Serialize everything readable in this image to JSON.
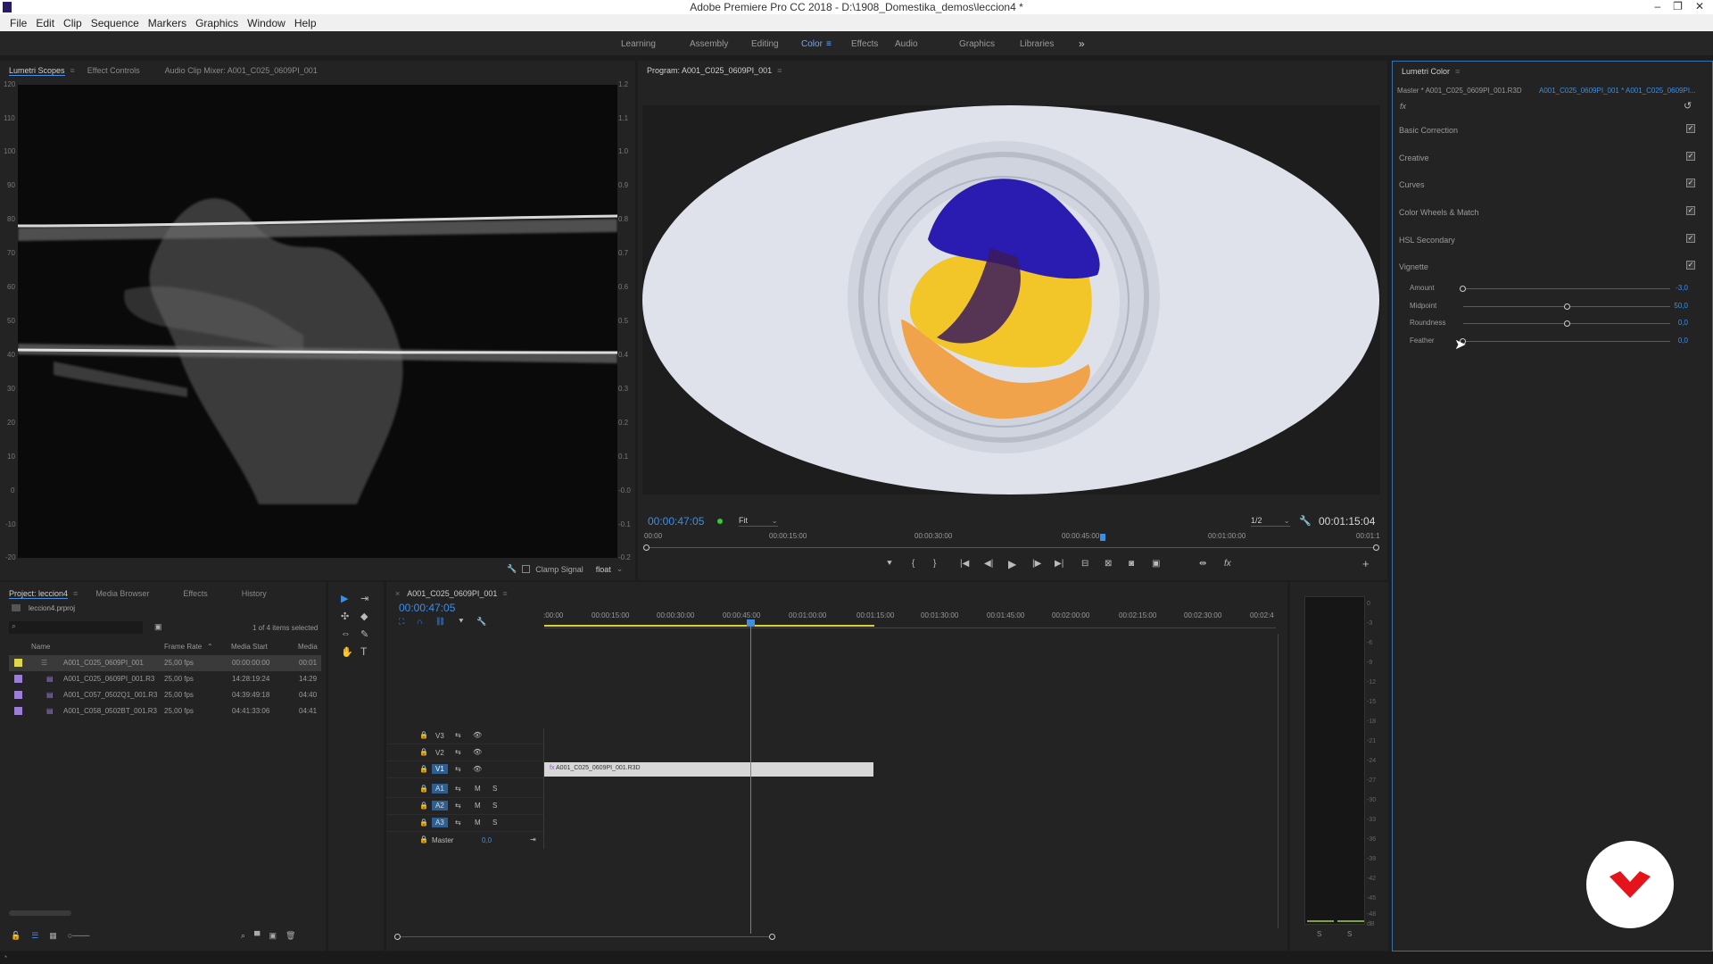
{
  "window": {
    "title": "Adobe Premiere Pro CC 2018 - D:\\1908_Domestika_demos\\leccion4 *",
    "min": "–",
    "restore": "❐",
    "close": "✕"
  },
  "menu": [
    "File",
    "Edit",
    "Clip",
    "Sequence",
    "Markers",
    "Graphics",
    "Window",
    "Help"
  ],
  "workspaces": {
    "tabs": [
      "Learning",
      "Assembly",
      "Editing",
      "Color",
      "Effects",
      "Audio",
      "Graphics",
      "Libraries"
    ],
    "active": "Color",
    "more": "»"
  },
  "scopes": {
    "tabs": [
      "Lumetri Scopes",
      "Effect Controls",
      "Audio Clip Mixer: A001_C025_0609PI_001"
    ],
    "left_ticks": [
      "120",
      "110",
      "100",
      "90",
      "80",
      "70",
      "60",
      "50",
      "40",
      "30",
      "20",
      "10",
      "0",
      "-10",
      "-20"
    ],
    "right_ticks": [
      "1.2",
      "1.1",
      "1.0",
      "0.9",
      "0.8",
      "0.7",
      "0.6",
      "0.5",
      "0.4",
      "0.3",
      "0.2",
      "0.1",
      "-0.0",
      "-0.1",
      "-0.2"
    ],
    "clamp_label": "Clamp Signal",
    "precision": "float"
  },
  "program": {
    "title": "Program: A001_C025_0609PI_001",
    "timecode": "00:00:47:05",
    "fit": "Fit",
    "resolution": "1/2",
    "duration": "00:01:15:04",
    "ruler": [
      "00:00",
      "00:00:15:00",
      "00:00:30:00",
      "00:00:45:00",
      "00:01:00:00",
      "00:01:1"
    ]
  },
  "lumetri": {
    "title": "Lumetri Color",
    "master": "Master * A001_C025_0609PI_001.R3D",
    "clip": "A001_C025_0609PI_001 * A001_C025_0609PI...",
    "fx": "fx",
    "sections": [
      "Basic Correction",
      "Creative",
      "Curves",
      "Color Wheels & Match",
      "HSL Secondary",
      "Vignette"
    ],
    "check": "✓",
    "vignette": [
      {
        "label": "Amount",
        "value": "-3,0",
        "pos": 0
      },
      {
        "label": "Midpoint",
        "value": "50,0",
        "pos": 0.5
      },
      {
        "label": "Roundness",
        "value": "0,0",
        "pos": 0.5
      },
      {
        "label": "Feather",
        "value": "0,0",
        "pos": 0
      }
    ]
  },
  "project": {
    "tabs": [
      "Project: leccion4",
      "Media Browser",
      "Effects",
      "History"
    ],
    "file": "leccion4.prproj",
    "selected": "1 of 4 items selected",
    "columns": [
      "Name",
      "Frame Rate",
      "Media Start",
      "Media"
    ],
    "rows": [
      {
        "name": "A001_C025_0609PI_001",
        "fps": "25,00 fps",
        "start": "00:00:00:00",
        "media": "00:01",
        "color": "#e0d84a"
      },
      {
        "name": "A001_C025_0609PI_001.R3",
        "fps": "25,00 fps",
        "start": "14:28:19:24",
        "media": "14:29",
        "color": "#9b7fd6"
      },
      {
        "name": "A001_C057_0502Q1_001.R3",
        "fps": "25,00 fps",
        "start": "04:39:49:18",
        "media": "04:40",
        "color": "#9b7fd6"
      },
      {
        "name": "A001_C058_0502BT_001.R3",
        "fps": "25,00 fps",
        "start": "04:41:33:06",
        "media": "04:41",
        "color": "#9b7fd6"
      }
    ]
  },
  "timeline": {
    "title": "A001_C025_0609PI_001",
    "timecode": "00:00:47:05",
    "ruler": [
      ":00:00",
      "00:00:15:00",
      "00:00:30:00",
      "00:00:45:00",
      "00:01:00:00",
      "00:01:15:00",
      "00:01:30:00",
      "00:01:45:00",
      "00:02:00:00",
      "00:02:15:00",
      "00:02:30:00",
      "00:02:4"
    ],
    "video_tracks": [
      "V3",
      "V2",
      "V1"
    ],
    "audio_tracks": [
      "A1",
      "A2",
      "A3"
    ],
    "master": "Master",
    "master_val": "0,0",
    "clip": "A001_C025_0609PI_001.R3D",
    "m": "M",
    "s": "S"
  },
  "meter": {
    "ticks": [
      "0",
      "-3",
      "-6",
      "-9",
      "-12",
      "-15",
      "-18",
      "-21",
      "-24",
      "-27",
      "-30",
      "-33",
      "-36",
      "-39",
      "-42",
      "-45",
      "-48",
      "dB"
    ],
    "solo": "S"
  },
  "tools": {
    "selection": "▶",
    "track_select": "⇥",
    "ripple": "✣",
    "razor": "◆",
    "slip": "⇔",
    "pen": "✎",
    "hand": "✋",
    "type": "T"
  },
  "colors": {
    "accent": "#3d8ee6",
    "panel": "#232323",
    "bg": "#1d1d1d",
    "logo": "#e5141b"
  }
}
